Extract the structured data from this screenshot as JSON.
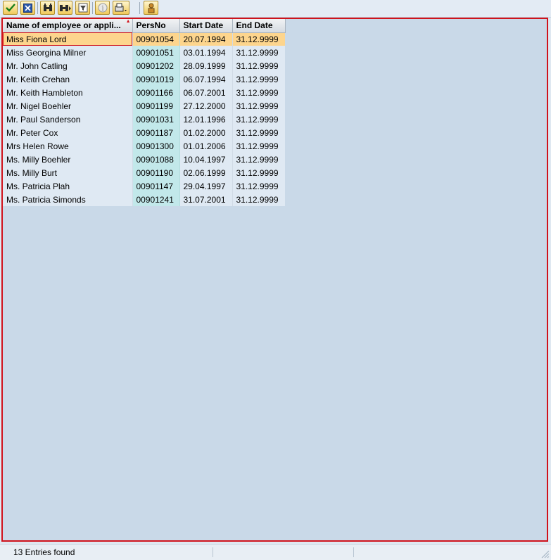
{
  "toolbar": {
    "buttons": [
      {
        "name": "check-icon",
        "title": "Continue"
      },
      {
        "name": "cancel-icon",
        "title": "Cancel"
      },
      {
        "name": "find-icon",
        "title": "Find"
      },
      {
        "name": "find-next-icon",
        "title": "Find Next"
      },
      {
        "name": "filter-icon",
        "title": "Filter"
      },
      {
        "name": "information-icon",
        "title": "Information"
      },
      {
        "name": "print-icon",
        "title": "Print"
      },
      {
        "name": "personal-settings-icon",
        "title": "Personal Settings"
      }
    ]
  },
  "table": {
    "columns": [
      "Name of employee or appli...",
      "PersNo",
      "Start Date",
      "End Date"
    ],
    "rows": [
      {
        "name": "Miss Fiona Lord",
        "persno": "00901054",
        "start": "20.07.1994",
        "end": "31.12.9999"
      },
      {
        "name": "Miss Georgina Milner",
        "persno": "00901051",
        "start": "03.01.1994",
        "end": "31.12.9999"
      },
      {
        "name": "Mr. John Catling",
        "persno": "00901202",
        "start": "28.09.1999",
        "end": "31.12.9999"
      },
      {
        "name": "Mr. Keith Crehan",
        "persno": "00901019",
        "start": "06.07.1994",
        "end": "31.12.9999"
      },
      {
        "name": "Mr. Keith Hambleton",
        "persno": "00901166",
        "start": "06.07.2001",
        "end": "31.12.9999"
      },
      {
        "name": "Mr. Nigel Boehler",
        "persno": "00901199",
        "start": "27.12.2000",
        "end": "31.12.9999"
      },
      {
        "name": "Mr. Paul Sanderson",
        "persno": "00901031",
        "start": "12.01.1996",
        "end": "31.12.9999"
      },
      {
        "name": "Mr. Peter Cox",
        "persno": "00901187",
        "start": "01.02.2000",
        "end": "31.12.9999"
      },
      {
        "name": "Mrs Helen Rowe",
        "persno": "00901300",
        "start": "01.01.2006",
        "end": "31.12.9999"
      },
      {
        "name": "Ms. Milly Boehler",
        "persno": "00901088",
        "start": "10.04.1997",
        "end": "31.12.9999"
      },
      {
        "name": "Ms. Milly Burt",
        "persno": "00901190",
        "start": "02.06.1999",
        "end": "31.12.9999"
      },
      {
        "name": "Ms. Patricia Plah",
        "persno": "00901147",
        "start": "29.04.1997",
        "end": "31.12.9999"
      },
      {
        "name": "Ms. Patricia Simonds",
        "persno": "00901241",
        "start": "31.07.2001",
        "end": "31.12.9999"
      }
    ],
    "selected_row": 0
  },
  "status": {
    "message": "13 Entries found"
  },
  "colors": {
    "selection": "#fdd58d",
    "frame_border": "#d0121b",
    "key_column": "#c2e8ea"
  }
}
